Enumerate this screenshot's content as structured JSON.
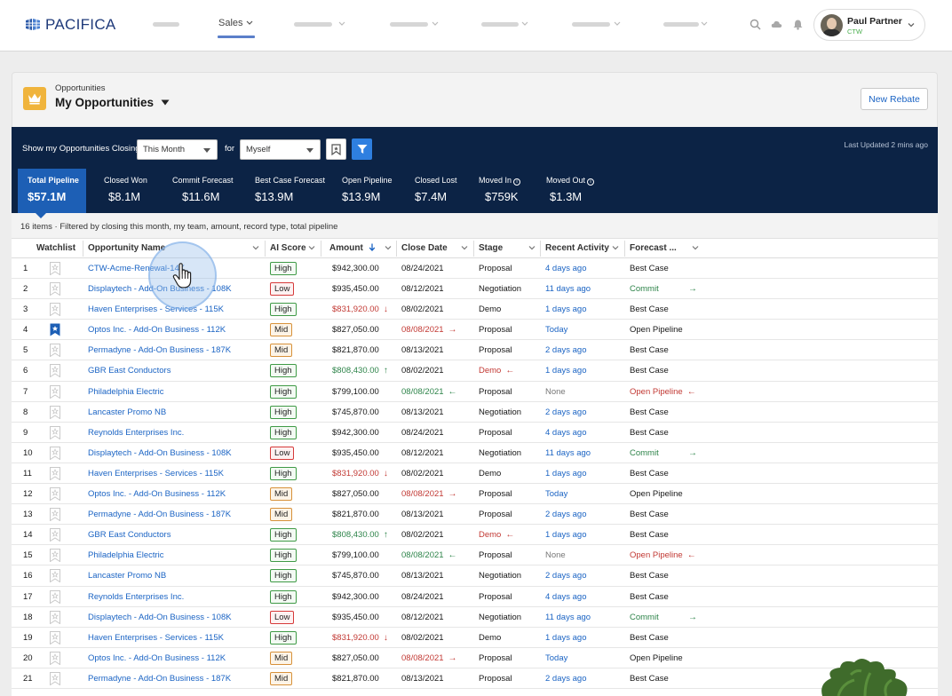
{
  "brand": {
    "logo": "PACIFICA"
  },
  "nav": {
    "active_tab": "Sales"
  },
  "user": {
    "name": "Paul Partner",
    "org": "CTW"
  },
  "header": {
    "object_label": "Opportunities",
    "list_title": "My Opportunities",
    "new_button": "New Rebate"
  },
  "filters": {
    "closing_label": "Show my Opportunities Closing",
    "period": "This Month",
    "for_label": "for",
    "owner": "Myself",
    "last_updated": "Last Updated 2 mins ago"
  },
  "kpis": [
    {
      "label": "Total Pipeline",
      "value": "$57.1M"
    },
    {
      "label": "Closed Won",
      "value": "$8.1M"
    },
    {
      "label": "Commit Forecast",
      "value": "$11.6M"
    },
    {
      "label": "Best Case Forecast",
      "value": "$13.9M"
    },
    {
      "label": "Open Pipeline",
      "value": "$13.9M"
    },
    {
      "label": "Closed Lost",
      "value": "$7.4M"
    },
    {
      "label": "Moved In",
      "value": "$759K"
    },
    {
      "label": "Moved Out",
      "value": "$1.3M"
    }
  ],
  "table": {
    "summary": "16 items · Filtered by closing this month, my team, amount, record type, total pipeline",
    "columns": [
      "Watchlist",
      "Opportunity Name",
      "AI Score",
      "Amount",
      "Close Date",
      "Stage",
      "Recent Activity",
      "Forecast ..."
    ],
    "rows": [
      {
        "num": "1",
        "watch": false,
        "name": "CTW-Acme-Renewal-14K",
        "score": "High",
        "amount": "$942,300.00",
        "amount_trend": "",
        "close": "08/24/2021",
        "close_trend": "",
        "stage": "Proposal",
        "stage_alert": false,
        "activity": "4 days ago",
        "forecast": "Best Case",
        "forecast_trend": ""
      },
      {
        "num": "2",
        "watch": false,
        "name": "Displaytech - Add-On Business - 108K",
        "score": "Low",
        "amount": "$935,450.00",
        "amount_trend": "",
        "close": "08/12/2021",
        "close_trend": "",
        "stage": "Negotiation",
        "stage_alert": false,
        "activity": "11 days ago",
        "forecast": "Commit",
        "forecast_trend": "right"
      },
      {
        "num": "3",
        "watch": false,
        "name": "Haven Enterprises - Services - 115K",
        "score": "High",
        "amount": "$831,920.00",
        "amount_trend": "down",
        "close": "08/02/2021",
        "close_trend": "",
        "stage": "Demo",
        "stage_alert": false,
        "activity": "1 days ago",
        "forecast": "Best Case",
        "forecast_trend": ""
      },
      {
        "num": "4",
        "watch": true,
        "name": "Optos Inc. - Add-On Business - 112K",
        "score": "Mid",
        "amount": "$827,050.00",
        "amount_trend": "",
        "close": "08/08/2021",
        "close_trend": "right",
        "stage": "Proposal",
        "stage_alert": false,
        "activity": "Today",
        "forecast": "Open Pipeline",
        "forecast_trend": ""
      },
      {
        "num": "5",
        "watch": false,
        "name": "Permadyne - Add-On Business - 187K",
        "score": "Mid",
        "amount": "$821,870.00",
        "amount_trend": "",
        "close": "08/13/2021",
        "close_trend": "",
        "stage": "Proposal",
        "stage_alert": false,
        "activity": "2 days ago",
        "forecast": "Best Case",
        "forecast_trend": ""
      },
      {
        "num": "6",
        "watch": false,
        "name": "GBR East Conductors",
        "score": "High",
        "amount": "$808,430.00",
        "amount_trend": "up",
        "close": "08/02/2021",
        "close_trend": "",
        "stage": "Demo",
        "stage_alert": true,
        "activity": "1 days ago",
        "forecast": "Best Case",
        "forecast_trend": ""
      },
      {
        "num": "7",
        "watch": false,
        "name": "Philadelphia Electric",
        "score": "High",
        "amount": "$799,100.00",
        "amount_trend": "",
        "close": "08/08/2021",
        "close_trend": "left",
        "stage": "Proposal",
        "stage_alert": false,
        "activity": "None",
        "forecast": "Open Pipeline",
        "forecast_trend": "left"
      },
      {
        "num": "8",
        "watch": false,
        "name": "Lancaster Promo NB",
        "score": "High",
        "amount": "$745,870.00",
        "amount_trend": "",
        "close": "08/13/2021",
        "close_trend": "",
        "stage": "Negotiation",
        "stage_alert": false,
        "activity": "2 days ago",
        "forecast": "Best Case",
        "forecast_trend": ""
      },
      {
        "num": "9",
        "watch": false,
        "name": "Reynolds Enterprises Inc.",
        "score": "High",
        "amount": "$942,300.00",
        "amount_trend": "",
        "close": "08/24/2021",
        "close_trend": "",
        "stage": "Proposal",
        "stage_alert": false,
        "activity": "4 days ago",
        "forecast": "Best Case",
        "forecast_trend": ""
      },
      {
        "num": "10",
        "watch": false,
        "name": "Displaytech - Add-On Business - 108K",
        "score": "Low",
        "amount": "$935,450.00",
        "amount_trend": "",
        "close": "08/12/2021",
        "close_trend": "",
        "stage": "Negotiation",
        "stage_alert": false,
        "activity": "11 days ago",
        "forecast": "Commit",
        "forecast_trend": "right"
      },
      {
        "num": "11",
        "watch": false,
        "name": "Haven Enterprises - Services - 115K",
        "score": "High",
        "amount": "$831,920.00",
        "amount_trend": "down",
        "close": "08/02/2021",
        "close_trend": "",
        "stage": "Demo",
        "stage_alert": false,
        "activity": "1 days ago",
        "forecast": "Best Case",
        "forecast_trend": ""
      },
      {
        "num": "12",
        "watch": false,
        "name": "Optos Inc. - Add-On Business - 112K",
        "score": "Mid",
        "amount": "$827,050.00",
        "amount_trend": "",
        "close": "08/08/2021",
        "close_trend": "right",
        "stage": "Proposal",
        "stage_alert": false,
        "activity": "Today",
        "forecast": "Open Pipeline",
        "forecast_trend": ""
      },
      {
        "num": "13",
        "watch": false,
        "name": "Permadyne - Add-On Business - 187K",
        "score": "Mid",
        "amount": "$821,870.00",
        "amount_trend": "",
        "close": "08/13/2021",
        "close_trend": "",
        "stage": "Proposal",
        "stage_alert": false,
        "activity": "2 days ago",
        "forecast": "Best Case",
        "forecast_trend": ""
      },
      {
        "num": "14",
        "watch": false,
        "name": "GBR East Conductors",
        "score": "High",
        "amount": "$808,430.00",
        "amount_trend": "up",
        "close": "08/02/2021",
        "close_trend": "",
        "stage": "Demo",
        "stage_alert": true,
        "activity": "1 days ago",
        "forecast": "Best Case",
        "forecast_trend": ""
      },
      {
        "num": "15",
        "watch": false,
        "name": "Philadelphia Electric",
        "score": "High",
        "amount": "$799,100.00",
        "amount_trend": "",
        "close": "08/08/2021",
        "close_trend": "left",
        "stage": "Proposal",
        "stage_alert": false,
        "activity": "None",
        "forecast": "Open Pipeline",
        "forecast_trend": "left"
      },
      {
        "num": "16",
        "watch": false,
        "name": "Lancaster Promo NB",
        "score": "High",
        "amount": "$745,870.00",
        "amount_trend": "",
        "close": "08/13/2021",
        "close_trend": "",
        "stage": "Negotiation",
        "stage_alert": false,
        "activity": "2 days ago",
        "forecast": "Best Case",
        "forecast_trend": ""
      },
      {
        "num": "17",
        "watch": false,
        "name": "Reynolds Enterprises Inc.",
        "score": "High",
        "amount": "$942,300.00",
        "amount_trend": "",
        "close": "08/24/2021",
        "close_trend": "",
        "stage": "Proposal",
        "stage_alert": false,
        "activity": "4 days ago",
        "forecast": "Best Case",
        "forecast_trend": ""
      },
      {
        "num": "18",
        "watch": false,
        "name": "Displaytech - Add-On Business - 108K",
        "score": "Low",
        "amount": "$935,450.00",
        "amount_trend": "",
        "close": "08/12/2021",
        "close_trend": "",
        "stage": "Negotiation",
        "stage_alert": false,
        "activity": "11 days ago",
        "forecast": "Commit",
        "forecast_trend": "right"
      },
      {
        "num": "19",
        "watch": false,
        "name": "Haven Enterprises - Services - 115K",
        "score": "High",
        "amount": "$831,920.00",
        "amount_trend": "down",
        "close": "08/02/2021",
        "close_trend": "",
        "stage": "Demo",
        "stage_alert": false,
        "activity": "1 days ago",
        "forecast": "Best Case",
        "forecast_trend": ""
      },
      {
        "num": "20",
        "watch": false,
        "name": "Optos Inc. - Add-On Business - 112K",
        "score": "Mid",
        "amount": "$827,050.00",
        "amount_trend": "",
        "close": "08/08/2021",
        "close_trend": "right",
        "stage": "Proposal",
        "stage_alert": false,
        "activity": "Today",
        "forecast": "Open Pipeline",
        "forecast_trend": ""
      },
      {
        "num": "21",
        "watch": false,
        "name": "Permadyne - Add-On Business - 187K",
        "score": "Mid",
        "amount": "$821,870.00",
        "amount_trend": "",
        "close": "08/13/2021",
        "close_trend": "",
        "stage": "Proposal",
        "stage_alert": false,
        "activity": "2 days ago",
        "forecast": "Best Case",
        "forecast_trend": ""
      }
    ]
  },
  "colors": {
    "nav_dark": "#0c2345",
    "kpi_active": "#1d5fb5",
    "link": "#1b64c4",
    "trend_up": "#2e844a",
    "trend_down": "#c23934"
  }
}
